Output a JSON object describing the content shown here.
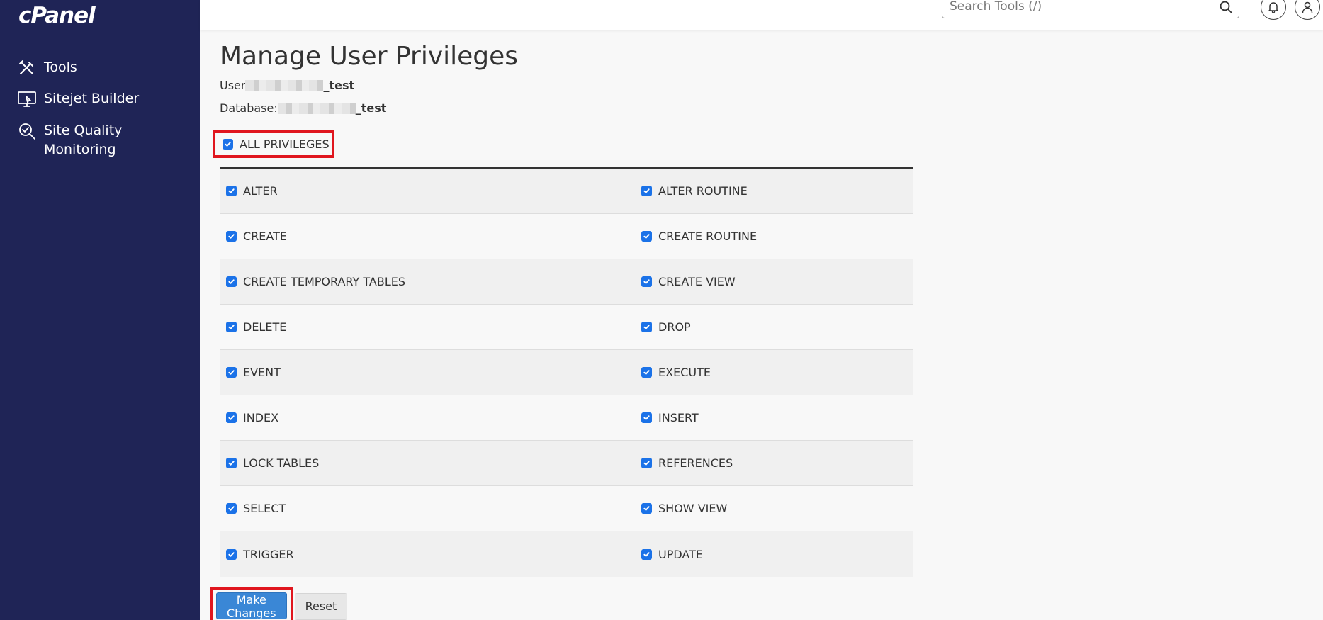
{
  "sidebar": {
    "logo": "cPanel",
    "items": [
      {
        "label": "Tools",
        "icon": "tools-icon"
      },
      {
        "label": "Sitejet Builder",
        "icon": "monitor-icon"
      },
      {
        "label": "Site Quality Monitoring",
        "icon": "magnifier-check-icon"
      }
    ]
  },
  "header": {
    "search_placeholder": "Search Tools (/)",
    "icons": [
      "search-icon",
      "bell-icon",
      "user-icon"
    ]
  },
  "main": {
    "title": "Manage User Privileges",
    "user_label": "User",
    "user_value": "_test",
    "database_label": "Database:",
    "database_value": "_test",
    "all_privileges": {
      "label": "ALL PRIVILEGES",
      "checked": true
    },
    "privileges": [
      {
        "left": "ALTER",
        "right": "ALTER ROUTINE"
      },
      {
        "left": "CREATE",
        "right": "CREATE ROUTINE"
      },
      {
        "left": "CREATE TEMPORARY TABLES",
        "right": "CREATE VIEW"
      },
      {
        "left": "DELETE",
        "right": "DROP"
      },
      {
        "left": "EVENT",
        "right": "EXECUTE"
      },
      {
        "left": "INDEX",
        "right": "INSERT"
      },
      {
        "left": "LOCK TABLES",
        "right": "REFERENCES"
      },
      {
        "left": "SELECT",
        "right": "SHOW VIEW"
      },
      {
        "left": "TRIGGER",
        "right": "UPDATE"
      }
    ],
    "all_checked": true,
    "make_changes_label": "Make Changes",
    "reset_label": "Reset"
  },
  "colors": {
    "sidebar_bg": "#1f2456",
    "checkbox": "#1b72e8",
    "primary_button": "#3a87d6",
    "highlight": "#e0161e"
  }
}
